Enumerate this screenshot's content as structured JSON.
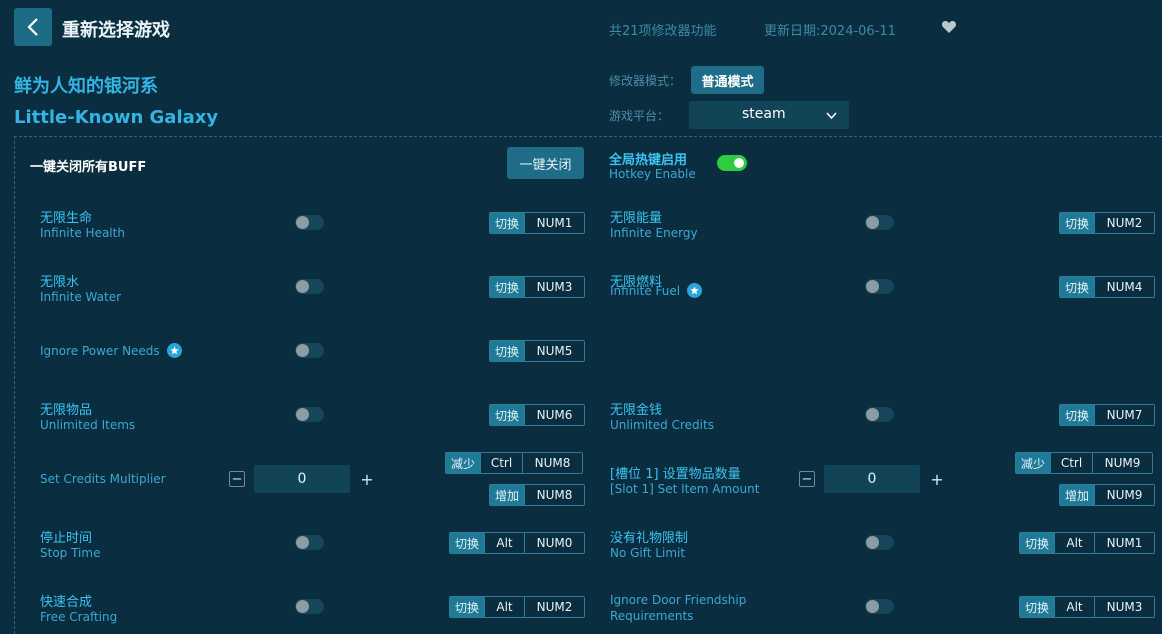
{
  "header": {
    "title": "重新选择游戏",
    "feature_count": "共21项修改器功能",
    "update_date": "更新日期:2024-06-11"
  },
  "game": {
    "title_cn": "鲜为人知的银河系",
    "title_en": "Little-Known Galaxy"
  },
  "settings": {
    "mode_label": "修改器模式：",
    "mode_value": "普通模式",
    "platform_label": "游戏平台：",
    "platform_value": "steam"
  },
  "global": {
    "buff_label": "一键关闭所有BUFF",
    "close_all_button": "一键关闭",
    "hotkey_cn": "全局热键启用",
    "hotkey_en": "Hotkey Enable",
    "hotkey_enabled": true
  },
  "options": [
    {
      "cn": "无限生命",
      "en": "Infinite Health",
      "action": "切换",
      "keys": [
        "NUM1"
      ]
    },
    {
      "cn": "无限能量",
      "en": "Infinite Energy",
      "action": "切换",
      "keys": [
        "NUM2"
      ]
    },
    {
      "cn": "无限水",
      "en": "Infinite Water",
      "action": "切换",
      "keys": [
        "NUM3"
      ]
    },
    {
      "cn": "无限燃料",
      "en": "Infinite Fuel",
      "action": "切换",
      "keys": [
        "NUM4"
      ],
      "starred": true
    },
    {
      "en": "Ignore Power Needs",
      "action": "切换",
      "keys": [
        "NUM5"
      ],
      "starred": true
    },
    {
      "cn": "无限物品",
      "en": "Unlimited Items",
      "action": "切换",
      "keys": [
        "NUM6"
      ]
    },
    {
      "cn": "无限金钱",
      "en": "Unlimited Credits",
      "action": "切换",
      "keys": [
        "NUM7"
      ]
    },
    {
      "en": "Set Credits Multiplier",
      "value": "0",
      "decrease": {
        "action": "减少",
        "keys": [
          "Ctrl",
          "NUM8"
        ]
      },
      "increase": {
        "action": "增加",
        "keys": [
          "NUM8"
        ]
      }
    },
    {
      "cn": "[槽位 1] 设置物品数量",
      "en": "[Slot 1] Set Item Amount",
      "value": "0",
      "decrease": {
        "action": "减少",
        "keys": [
          "Ctrl",
          "NUM9"
        ]
      },
      "increase": {
        "action": "增加",
        "keys": [
          "NUM9"
        ]
      }
    },
    {
      "cn": "停止时间",
      "en": "Stop Time",
      "action": "切换",
      "keys": [
        "Alt",
        "NUM0"
      ]
    },
    {
      "cn": "没有礼物限制",
      "en": "No Gift Limit",
      "action": "切换",
      "keys": [
        "Alt",
        "NUM1"
      ]
    },
    {
      "cn": "快速合成",
      "en": "Free Crafting",
      "action": "切换",
      "keys": [
        "Alt",
        "NUM2"
      ]
    },
    {
      "en1": "Ignore Door Friendship",
      "en2": "Requirements",
      "action": "切换",
      "keys": [
        "Alt",
        "NUM3"
      ]
    }
  ],
  "num_controls": {
    "minus": "−",
    "plus": "+"
  }
}
